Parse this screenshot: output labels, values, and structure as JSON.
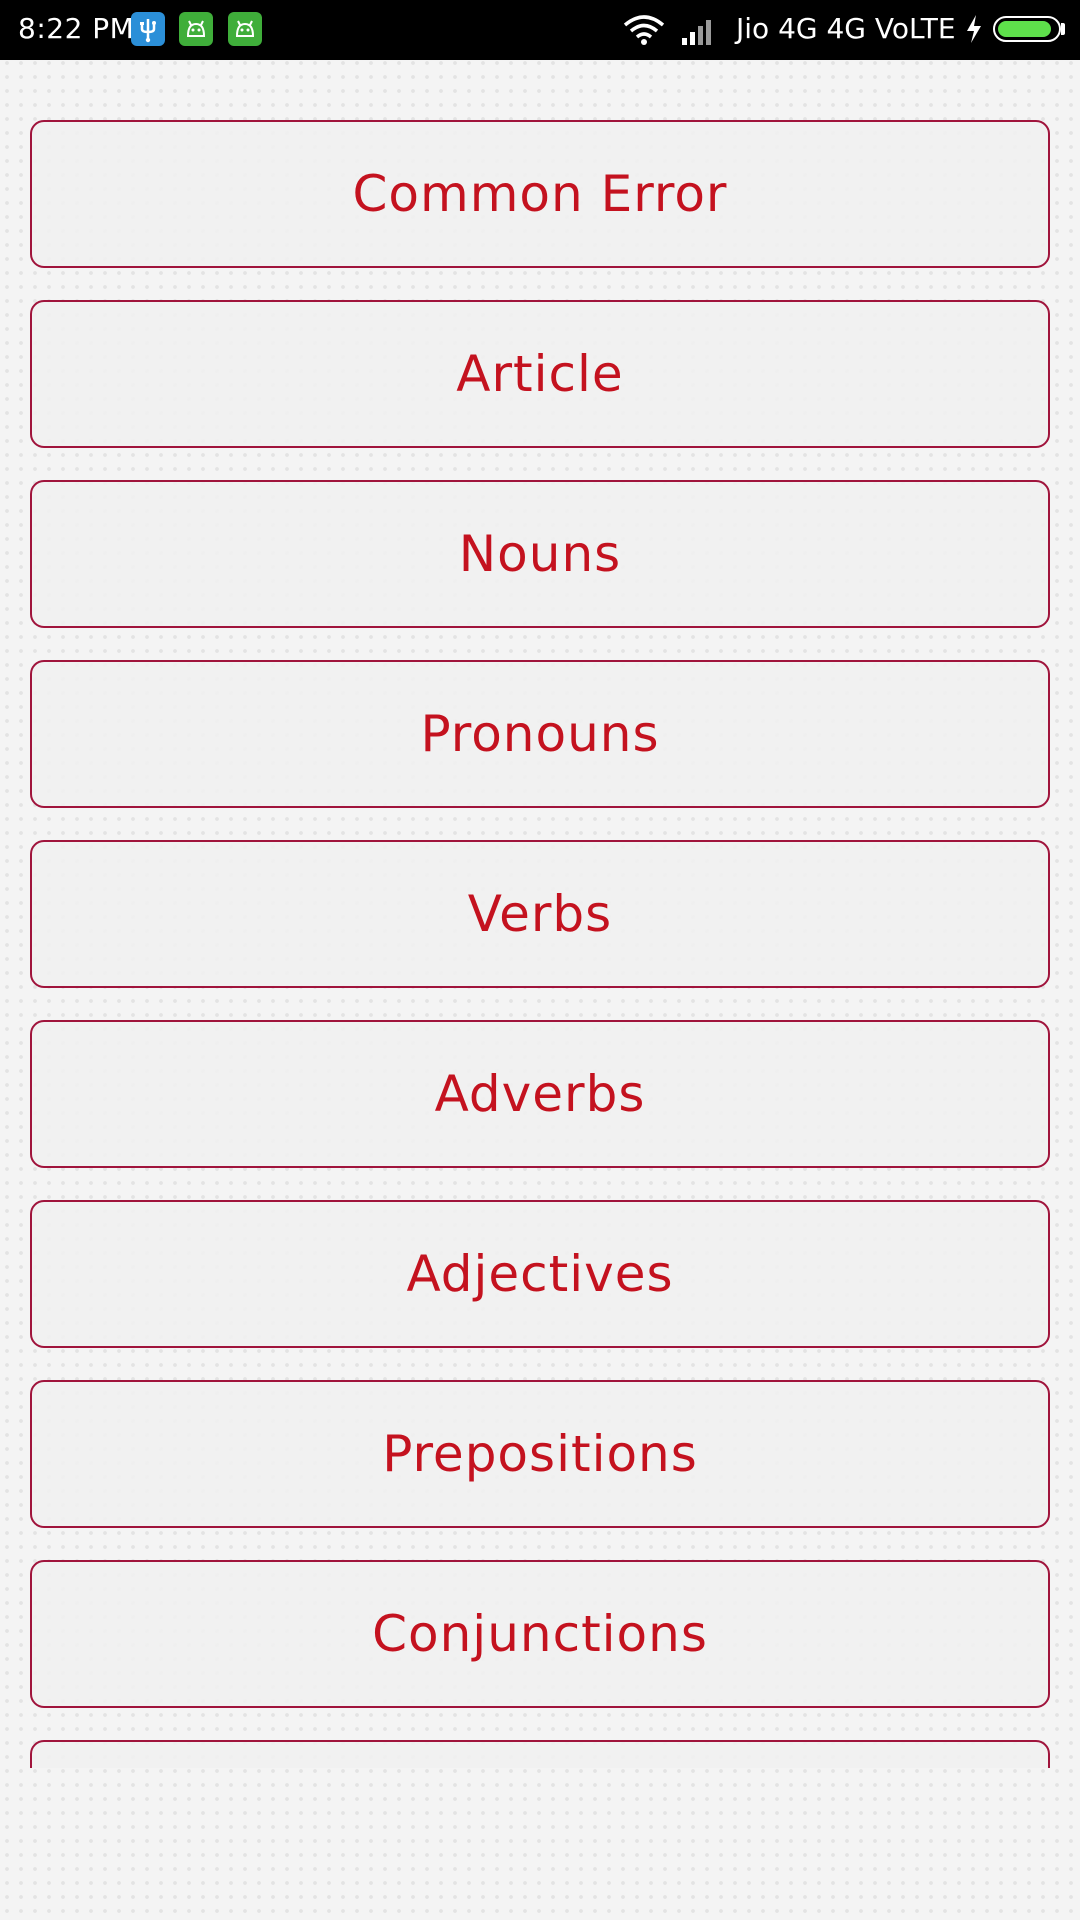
{
  "status_bar": {
    "time": "8:22 PM",
    "carrier": "Jio 4G 4G  VoLTE",
    "battery_level": 0.92,
    "notification_icons": [
      "usb-icon",
      "android-app-icon",
      "android-app-icon"
    ],
    "system_icons": [
      "wifi-icon",
      "signal-icon",
      "charging-icon",
      "battery-icon"
    ]
  },
  "colors": {
    "accent_text": "#c4121f",
    "card_border": "#a0143c",
    "card_background": "#f0f0f0",
    "page_background": "#f4f4f4"
  },
  "topics": [
    {
      "label": "Common Error"
    },
    {
      "label": "Article"
    },
    {
      "label": "Nouns"
    },
    {
      "label": "Pronouns"
    },
    {
      "label": "Verbs"
    },
    {
      "label": "Adverbs"
    },
    {
      "label": "Adjectives"
    },
    {
      "label": "Prepositions"
    },
    {
      "label": "Conjunctions"
    },
    {
      "label": ""
    }
  ]
}
